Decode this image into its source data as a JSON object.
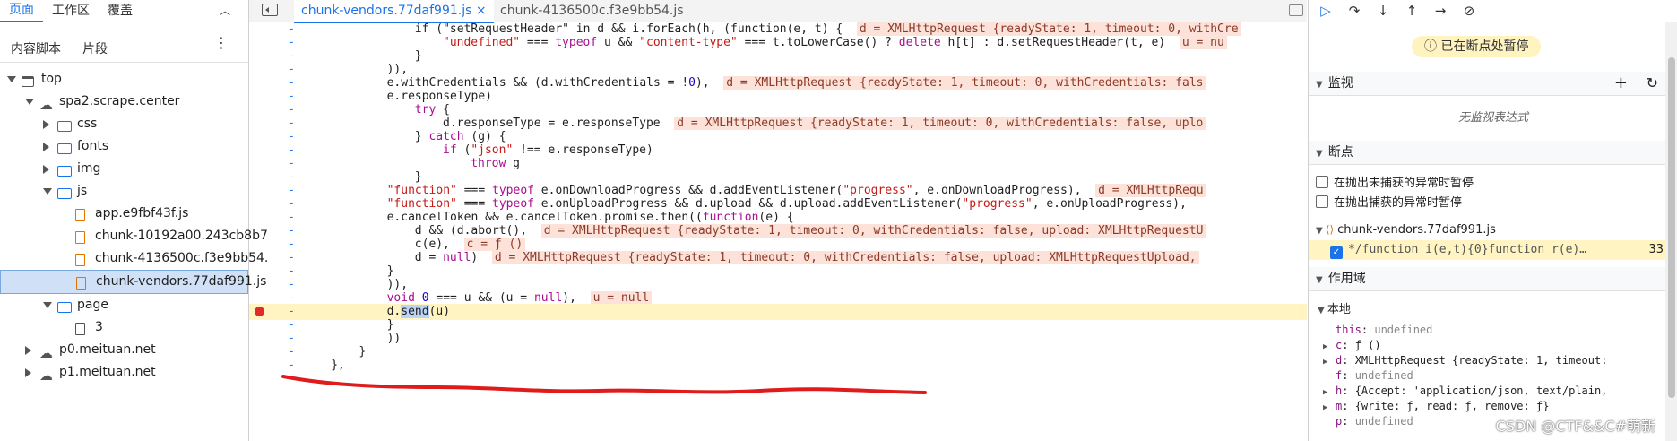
{
  "left": {
    "tabs": [
      "页面",
      "工作区",
      "覆盖"
    ],
    "subtabs": [
      "内容脚本",
      "片段"
    ],
    "tree": [
      {
        "label": "top",
        "depth": 0,
        "icon": "frame-icon",
        "expanded": true
      },
      {
        "label": "spa2.scrape.center",
        "depth": 1,
        "icon": "cloud-icon",
        "expanded": true
      },
      {
        "label": "css",
        "depth": 2,
        "icon": "folder-icon",
        "expanded": false
      },
      {
        "label": "fonts",
        "depth": 2,
        "icon": "folder-icon",
        "expanded": false
      },
      {
        "label": "img",
        "depth": 2,
        "icon": "folder-icon",
        "expanded": false
      },
      {
        "label": "js",
        "depth": 2,
        "icon": "folder-icon",
        "expanded": true
      },
      {
        "label": "app.e9fbf43f.js",
        "depth": 3,
        "icon": "file-icon"
      },
      {
        "label": "chunk-10192a00.243cb8b7",
        "depth": 3,
        "icon": "file-icon"
      },
      {
        "label": "chunk-4136500c.f3e9bb54.",
        "depth": 3,
        "icon": "file-icon"
      },
      {
        "label": "chunk-vendors.77daf991.js",
        "depth": 3,
        "icon": "file-icon",
        "selected": true
      },
      {
        "label": "page",
        "depth": 2,
        "icon": "folder-icon",
        "expanded": true
      },
      {
        "label": "3",
        "depth": 3,
        "icon": "doc-icon"
      },
      {
        "label": "p0.meituan.net",
        "depth": 1,
        "icon": "cloud-icon",
        "expanded": false
      },
      {
        "label": "p1.meituan.net",
        "depth": 1,
        "icon": "cloud-icon",
        "expanded": false
      }
    ]
  },
  "editor": {
    "tabs": [
      {
        "label": "chunk-vendors.77daf991.js",
        "active": true,
        "close": "×"
      },
      {
        "label": "chunk-4136500c.f3e9bb54.js",
        "active": false
      }
    ],
    "lines": [
      {
        "g": "-",
        "indent": 16,
        "html": "if (\"setRequestHeader\" in d && i.forEach(h, (function(e, t) {  <span class=\"inl\">d = XMLHttpRequest {readyState: 1, timeout: 0, withCre</span>"
      },
      {
        "g": "-",
        "indent": 20,
        "html": "<span class=\"str\">\"undefined\"</span> === <span class=\"kw\">typeof</span> u && <span class=\"str\">\"content-type\"</span> === t.toLowerCase() ? <span class=\"kw\">delete</span> h[t] : d.setRequestHeader(t, e)  <span class=\"inl\">u = nu</span>"
      },
      {
        "g": "-",
        "indent": 16,
        "html": "}"
      },
      {
        "g": "-",
        "indent": 12,
        "html": ")),"
      },
      {
        "g": "-",
        "indent": 12,
        "html": "e.withCredentials && (d.withCredentials = !<span class=\"num\">0</span>),  <span class=\"inl\">d = XMLHttpRequest {readyState: 1, timeout: 0, withCredentials: fals</span>"
      },
      {
        "g": "-",
        "indent": 12,
        "html": "e.responseType)"
      },
      {
        "g": "-",
        "indent": 16,
        "html": "<span class=\"kw\">try</span> {"
      },
      {
        "g": "-",
        "indent": 20,
        "html": "d.responseType = e.responseType  <span class=\"inl\">d = XMLHttpRequest {readyState: 1, timeout: 0, withCredentials: false, uplo</span>"
      },
      {
        "g": "-",
        "indent": 16,
        "html": "} <span class=\"kw\">catch</span> (g) {"
      },
      {
        "g": "-",
        "indent": 20,
        "html": "<span class=\"kw\">if</span> (<span class=\"str\">\"json\"</span> !== e.responseType)"
      },
      {
        "g": "-",
        "indent": 24,
        "html": "<span class=\"kw\">throw</span> g"
      },
      {
        "g": "-",
        "indent": 16,
        "html": "}"
      },
      {
        "g": "-",
        "indent": 12,
        "html": "<span class=\"str\">\"function\"</span> === <span class=\"kw\">typeof</span> e.onDownloadProgress && d.addEventListener(<span class=\"str\">\"progress\"</span>, e.onDownloadProgress),  <span class=\"inl\">d = XMLHttpRequ</span>"
      },
      {
        "g": "-",
        "indent": 12,
        "html": "<span class=\"str\">\"function\"</span> === <span class=\"kw\">typeof</span> e.onUploadProgress && d.upload && d.upload.addEventListener(<span class=\"str\">\"progress\"</span>, e.onUploadProgress),"
      },
      {
        "g": "-",
        "indent": 12,
        "html": "e.cancelToken && e.cancelToken.promise.then((<span class=\"kw\">function</span>(e) {"
      },
      {
        "g": "-",
        "indent": 16,
        "html": "d && (d.abort(),  <span class=\"inl\">d = XMLHttpRequest {readyState: 1, timeout: 0, withCredentials: false, upload: XMLHttpRequestU</span>"
      },
      {
        "g": "-",
        "indent": 16,
        "html": "c(e),  <span class=\"inl\">c = ƒ ()</span>"
      },
      {
        "g": "-",
        "indent": 16,
        "html": "d = <span class=\"kw\">null</span>)  <span class=\"inl\">d = XMLHttpRequest {readyState: 1, timeout: 0, withCredentials: false, upload: XMLHttpRequestUpload,</span>"
      },
      {
        "g": "-",
        "indent": 12,
        "html": "}"
      },
      {
        "g": "-",
        "indent": 12,
        "html": ")),"
      },
      {
        "g": "-",
        "indent": 12,
        "html": "<span class=\"kw\">void</span> <span class=\"num\">0</span> === u && (u = <span class=\"kw\">null</span>),  <span class=\"inl\">u = null</span>"
      },
      {
        "g": "-",
        "indent": 12,
        "html": "d.<span style=\"background:#b9d4f5\">send</span>(u)",
        "highlight": true,
        "breakpoint": true
      },
      {
        "g": "-",
        "indent": 12,
        "html": "}"
      },
      {
        "g": "-",
        "indent": 12,
        "html": "))"
      },
      {
        "g": "-",
        "indent": 8,
        "html": "}"
      },
      {
        "g": "-",
        "indent": 4,
        "html": "},"
      }
    ]
  },
  "debugger": {
    "paused_label": "已在断点处暂停",
    "watch_title": "监视",
    "watch_empty": "无监视表达式",
    "breakpoints_title": "断点",
    "bp_uncaught": "在抛出未捕获的异常时暂停",
    "bp_caught": "在抛出捕获的异常时暂停",
    "bp_file": "chunk-vendors.77daf991.js",
    "bp_entry": "*/function i(e,t){0}function r(e)…",
    "bp_line": "33",
    "scope_title": "作用域",
    "local_title": "本地",
    "scope_vars": [
      {
        "name": "this",
        "value": "undefined",
        "expandable": false
      },
      {
        "name": "c",
        "value": "ƒ ()",
        "expandable": true
      },
      {
        "name": "d",
        "value": "XMLHttpRequest {readyState: 1, timeout:",
        "expandable": true
      },
      {
        "name": "f",
        "value": "undefined",
        "expandable": false
      },
      {
        "name": "h",
        "value": "{Accept: 'application/json, text/plain,",
        "expandable": true
      },
      {
        "name": "m",
        "value": "{write: ƒ, read: ƒ, remove: ƒ}",
        "expandable": true
      },
      {
        "name": "p",
        "value": "undefined",
        "expandable": false
      }
    ]
  },
  "watermark": "CSDN @CTF&&C#萌新"
}
